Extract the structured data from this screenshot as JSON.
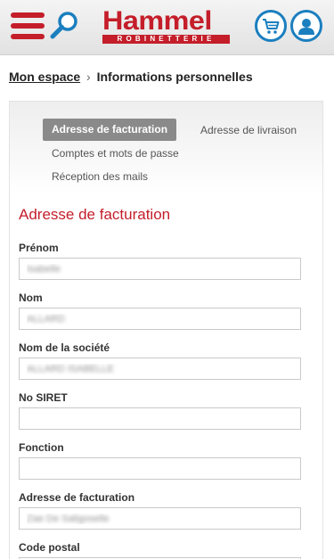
{
  "header": {
    "logo_text": "Hammel",
    "logo_subtext": "ROBINETTERIE",
    "menu_icon": "hamburger-menu-icon",
    "search_icon": "search-icon",
    "cart_icon": "cart-icon",
    "account_icon": "user-icon",
    "brand_red": "#c41e2a",
    "brand_blue": "#1b7fbf"
  },
  "breadcrumb": {
    "home_label": "Mon espace",
    "separator": "›",
    "current_label": "Informations personnelles"
  },
  "account_nav": {
    "items": [
      {
        "label": "Adresse de facturation",
        "active": true
      },
      {
        "label": "Adresse de livraison",
        "active": false
      },
      {
        "label": "Comptes et mots de passe",
        "active": false
      },
      {
        "label": "Réception des mails",
        "active": false
      }
    ]
  },
  "form": {
    "title": "Adresse de facturation",
    "fields": [
      {
        "label": "Prénom",
        "value": "Isabelle"
      },
      {
        "label": "Nom",
        "value": "ALLARD"
      },
      {
        "label": "Nom de la société",
        "value": "ALLARD ISABELLE"
      },
      {
        "label": "No SIRET",
        "value": ""
      },
      {
        "label": "Fonction",
        "value": ""
      },
      {
        "label": "Adresse de facturation",
        "value": "Zae De Saligoselle"
      },
      {
        "label": "Code postal",
        "value": ""
      }
    ]
  }
}
